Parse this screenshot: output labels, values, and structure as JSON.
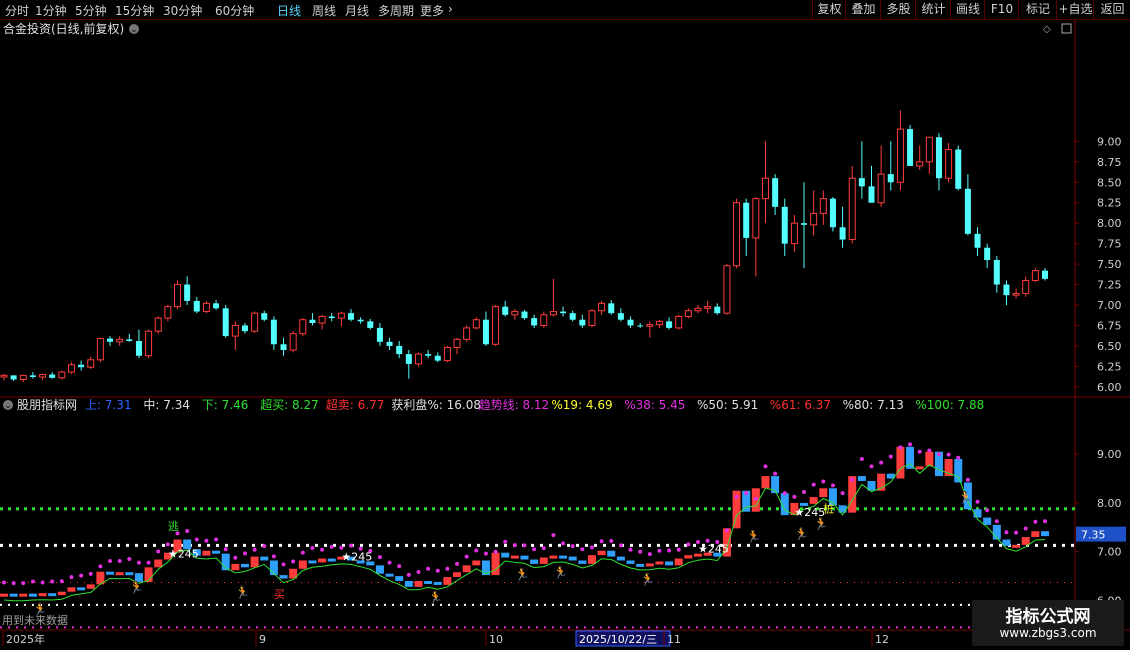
{
  "toolbar": {
    "periods": [
      "分时",
      "1分钟",
      "5分钟",
      "15分钟",
      "30分钟",
      "60分钟",
      "日线",
      "周线",
      "月线",
      "多周期",
      "更多"
    ],
    "active_period": "日线",
    "right_buttons": [
      "复权",
      "叠加",
      "多股",
      "统计",
      "画线",
      "F10",
      "标记",
      "+自选",
      "返回"
    ]
  },
  "main_panel": {
    "title": "合金投资(日线,前复权)",
    "y_ticks": [
      "9.00",
      "8.75",
      "8.50",
      "8.25",
      "8.00",
      "7.75",
      "7.50",
      "7.25",
      "7.00",
      "6.75",
      "6.50",
      "6.25",
      "6.00"
    ]
  },
  "indicator_panel": {
    "name": "股朋指标网",
    "values": [
      {
        "label": "上:",
        "value": "7.31",
        "color": "#3060ff"
      },
      {
        "label": "中:",
        "value": "7.34",
        "color": "#e0e0e0"
      },
      {
        "label": "下:",
        "value": "7.46",
        "color": "#30e030"
      },
      {
        "label": "超买:",
        "value": "8.27",
        "color": "#30e030"
      },
      {
        "label": "超卖:",
        "value": "6.77",
        "color": "#ff3030"
      },
      {
        "label": "获利盘%:",
        "value": "16.08",
        "color": "#e0e0e0"
      },
      {
        "label": "趋势线:",
        "value": "8.12",
        "color": "#e030e0"
      },
      {
        "label": "%19:",
        "value": "4.69",
        "color": "#ffff30"
      },
      {
        "label": "%38:",
        "value": "5.45",
        "color": "#e030e0"
      },
      {
        "label": "%50:",
        "value": "5.91",
        "color": "#e0e0e0"
      },
      {
        "label": "%61:",
        "value": "6.37",
        "color": "#ff3030"
      },
      {
        "label": "%80:",
        "value": "7.13",
        "color": "#e0e0e0"
      },
      {
        "label": "%100:",
        "value": "7.88",
        "color": "#30e030"
      }
    ],
    "y_ticks": [
      "9.00",
      "8.00",
      "7.00",
      "6.00"
    ],
    "current_price": "7.35",
    "future_note": "用到未来数据",
    "markers": {
      "buy": "买",
      "star": "★245",
      "dou": "逃",
      "zhuang": "桩"
    }
  },
  "x_axis": {
    "labels": [
      "2025年",
      "9",
      "10",
      "2025/10/22/三",
      "11",
      "12"
    ]
  },
  "watermark": {
    "line1": "指标公式网",
    "line2": "www.zbgs3.com"
  },
  "chart_data": {
    "type": "candlestick",
    "title": "合金投资(日线,前复权)",
    "ylim": [
      5.9,
      10.3
    ],
    "x_labels": [
      "2025年",
      "9",
      "10",
      "11",
      "12"
    ],
    "candles": [
      [
        6.12,
        6.16,
        6.08,
        6.14
      ],
      [
        6.14,
        6.14,
        6.07,
        6.09
      ],
      [
        6.09,
        6.15,
        6.06,
        6.14
      ],
      [
        6.14,
        6.18,
        6.1,
        6.12
      ],
      [
        6.12,
        6.16,
        6.08,
        6.15
      ],
      [
        6.15,
        6.18,
        6.1,
        6.11
      ],
      [
        6.11,
        6.2,
        6.09,
        6.18
      ],
      [
        6.18,
        6.3,
        6.16,
        6.27
      ],
      [
        6.27,
        6.32,
        6.2,
        6.24
      ],
      [
        6.24,
        6.37,
        6.22,
        6.33
      ],
      [
        6.33,
        6.6,
        6.3,
        6.59
      ],
      [
        6.59,
        6.62,
        6.5,
        6.55
      ],
      [
        6.55,
        6.62,
        6.5,
        6.58
      ],
      [
        6.58,
        6.65,
        6.55,
        6.56
      ],
      [
        6.56,
        6.7,
        6.35,
        6.38
      ],
      [
        6.38,
        6.7,
        6.35,
        6.68
      ],
      [
        6.68,
        6.86,
        6.65,
        6.84
      ],
      [
        6.84,
        7.0,
        6.8,
        6.98
      ],
      [
        6.98,
        7.3,
        6.95,
        7.25
      ],
      [
        7.25,
        7.35,
        7.0,
        7.05
      ],
      [
        7.05,
        7.1,
        6.9,
        6.92
      ],
      [
        6.92,
        7.05,
        6.9,
        7.02
      ],
      [
        7.02,
        7.06,
        6.94,
        6.96
      ],
      [
        6.96,
        7.0,
        6.6,
        6.62
      ],
      [
        6.62,
        6.8,
        6.45,
        6.75
      ],
      [
        6.75,
        6.78,
        6.65,
        6.68
      ],
      [
        6.68,
        6.92,
        6.66,
        6.9
      ],
      [
        6.9,
        6.93,
        6.8,
        6.82
      ],
      [
        6.82,
        6.86,
        6.45,
        6.52
      ],
      [
        6.52,
        6.6,
        6.38,
        6.45
      ],
      [
        6.45,
        6.68,
        6.42,
        6.65
      ],
      [
        6.65,
        6.84,
        6.62,
        6.82
      ],
      [
        6.82,
        6.9,
        6.75,
        6.78
      ],
      [
        6.78,
        6.88,
        6.7,
        6.86
      ],
      [
        6.86,
        6.9,
        6.8,
        6.84
      ],
      [
        6.84,
        6.92,
        6.74,
        6.9
      ],
      [
        6.9,
        6.95,
        6.8,
        6.82
      ],
      [
        6.82,
        6.85,
        6.77,
        6.8
      ],
      [
        6.8,
        6.83,
        6.7,
        6.72
      ],
      [
        6.72,
        6.78,
        6.5,
        6.55
      ],
      [
        6.55,
        6.6,
        6.45,
        6.5
      ],
      [
        6.5,
        6.56,
        6.35,
        6.4
      ],
      [
        6.4,
        6.45,
        6.1,
        6.28
      ],
      [
        6.28,
        6.42,
        6.25,
        6.4
      ],
      [
        6.4,
        6.45,
        6.35,
        6.38
      ],
      [
        6.38,
        6.42,
        6.3,
        6.32
      ],
      [
        6.32,
        6.5,
        6.3,
        6.48
      ],
      [
        6.48,
        6.6,
        6.4,
        6.58
      ],
      [
        6.58,
        6.75,
        6.55,
        6.72
      ],
      [
        6.72,
        6.85,
        6.7,
        6.82
      ],
      [
        6.82,
        6.92,
        6.5,
        6.52
      ],
      [
        6.52,
        7.0,
        6.5,
        6.98
      ],
      [
        6.98,
        7.05,
        6.86,
        6.88
      ],
      [
        6.88,
        6.95,
        6.82,
        6.92
      ],
      [
        6.92,
        6.94,
        6.82,
        6.84
      ],
      [
        6.84,
        6.88,
        6.72,
        6.75
      ],
      [
        6.75,
        6.92,
        6.72,
        6.88
      ],
      [
        6.88,
        7.32,
        6.86,
        6.92
      ],
      [
        6.92,
        6.98,
        6.86,
        6.9
      ],
      [
        6.9,
        6.93,
        6.8,
        6.82
      ],
      [
        6.82,
        6.88,
        6.72,
        6.75
      ],
      [
        6.75,
        6.95,
        6.73,
        6.93
      ],
      [
        6.93,
        7.05,
        6.88,
        7.02
      ],
      [
        7.02,
        7.06,
        6.88,
        6.9
      ],
      [
        6.9,
        6.96,
        6.8,
        6.82
      ],
      [
        6.82,
        6.86,
        6.72,
        6.75
      ],
      [
        6.75,
        6.78,
        6.72,
        6.74
      ],
      [
        6.74,
        6.8,
        6.6,
        6.76
      ],
      [
        6.76,
        6.82,
        6.72,
        6.8
      ],
      [
        6.8,
        6.85,
        6.7,
        6.72
      ],
      [
        6.72,
        6.88,
        6.7,
        6.86
      ],
      [
        6.86,
        6.96,
        6.84,
        6.93
      ],
      [
        6.93,
        7.0,
        6.9,
        6.96
      ],
      [
        6.96,
        7.05,
        6.9,
        6.98
      ],
      [
        6.98,
        7.02,
        6.88,
        6.9
      ],
      [
        6.9,
        7.5,
        6.88,
        7.48
      ],
      [
        7.48,
        8.3,
        7.45,
        8.25
      ],
      [
        8.25,
        8.3,
        7.6,
        7.82
      ],
      [
        7.82,
        8.32,
        7.35,
        8.3
      ],
      [
        8.3,
        9.0,
        8.0,
        8.55
      ],
      [
        8.55,
        8.6,
        8.1,
        8.2
      ],
      [
        8.2,
        8.3,
        7.6,
        7.75
      ],
      [
        7.75,
        8.1,
        7.65,
        8.0
      ],
      [
        8.0,
        8.5,
        7.45,
        7.98
      ],
      [
        7.98,
        8.4,
        7.85,
        8.12
      ],
      [
        8.12,
        8.4,
        7.98,
        8.3
      ],
      [
        8.3,
        8.32,
        7.9,
        7.95
      ],
      [
        7.95,
        8.2,
        7.7,
        7.8
      ],
      [
        7.8,
        8.7,
        7.75,
        8.55
      ],
      [
        8.55,
        9.0,
        8.3,
        8.45
      ],
      [
        8.45,
        8.7,
        8.3,
        8.25
      ],
      [
        8.25,
        8.95,
        8.2,
        8.6
      ],
      [
        8.6,
        9.0,
        8.4,
        8.5
      ],
      [
        8.5,
        9.38,
        8.4,
        9.15
      ],
      [
        9.15,
        9.2,
        8.7,
        8.7
      ],
      [
        8.7,
        8.95,
        8.65,
        8.75
      ],
      [
        8.75,
        9.05,
        8.6,
        9.05
      ],
      [
        9.05,
        9.1,
        8.4,
        8.55
      ],
      [
        8.55,
        8.98,
        8.5,
        8.9
      ],
      [
        8.9,
        8.95,
        8.4,
        8.42
      ],
      [
        8.42,
        8.6,
        7.85,
        7.87
      ],
      [
        7.87,
        7.95,
        7.6,
        7.7
      ],
      [
        7.7,
        7.75,
        7.45,
        7.55
      ],
      [
        7.55,
        7.6,
        7.15,
        7.25
      ],
      [
        7.25,
        7.3,
        7.0,
        7.12
      ],
      [
        7.12,
        7.2,
        7.08,
        7.14
      ],
      [
        7.14,
        7.35,
        7.1,
        7.3
      ],
      [
        7.3,
        7.45,
        7.28,
        7.42
      ],
      [
        7.42,
        7.45,
        7.3,
        7.32
      ]
    ]
  }
}
